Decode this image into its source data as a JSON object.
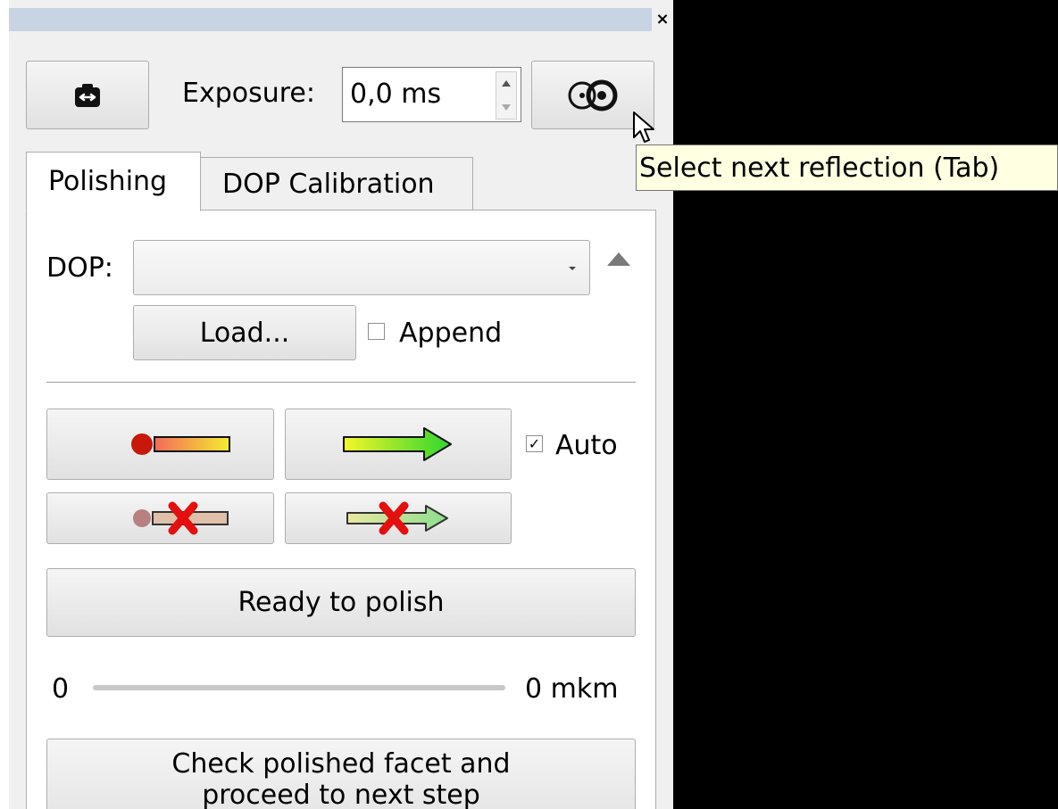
{
  "window": {
    "close_glyph": "×"
  },
  "toolbar": {
    "camera_icon": "camera-switch-icon",
    "exposure_label": "Exposure:",
    "exposure_value": "0,0 ms",
    "reflection_icon": "select-reflection-icon"
  },
  "tabs": [
    {
      "label": "Polishing",
      "active": true
    },
    {
      "label": "DOP Calibration",
      "active": false
    }
  ],
  "polishing": {
    "dop_label": "DOP:",
    "dop_value": "",
    "load_label": "Load...",
    "append_label": "Append",
    "append_checked": false,
    "auto_label": "Auto",
    "auto_checked": true,
    "check_mark": "✓",
    "ready_label": "Ready to polish",
    "slider_min": "0",
    "slider_max": "0 mkm",
    "check_facet_line1": "Check polished facet and",
    "check_facet_line2": "proceed to next step"
  },
  "tooltip": {
    "text": "Select next reflection (Tab)"
  },
  "colors": {
    "title_bar": "#c8d4e3",
    "tooltip_bg": "#ffffe1",
    "panel_bg": "#f0f0f0"
  }
}
